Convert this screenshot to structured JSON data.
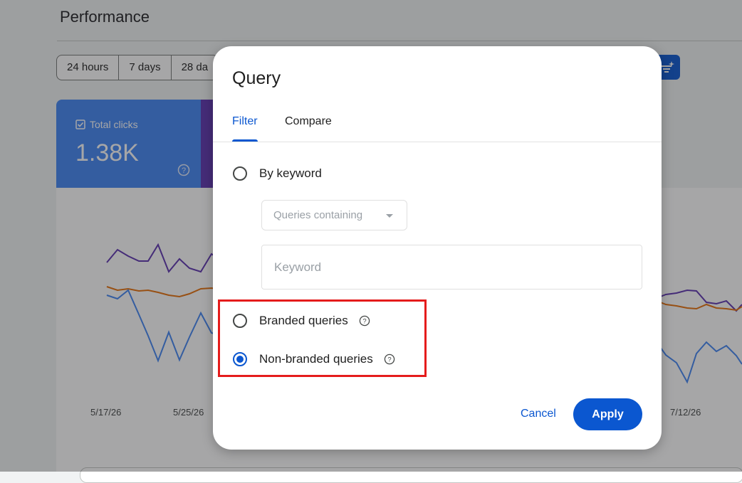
{
  "background": {
    "page_title": "Performance",
    "date_ranges": [
      "24 hours",
      "7 days",
      "28 da"
    ],
    "metric_card": {
      "label": "Total clicks",
      "value": "1.38K"
    },
    "x_ticks": [
      "5/17/26",
      "5/25/26",
      "7/12/26"
    ]
  },
  "dialog": {
    "title": "Query",
    "tabs": {
      "filter": "Filter",
      "compare": "Compare"
    },
    "options": {
      "by_keyword": "By keyword",
      "branded": "Branded queries",
      "non_branded": "Non-branded queries"
    },
    "selected_option": "non_branded",
    "match_select": "Queries containing",
    "keyword_placeholder": "Keyword",
    "cancel_label": "Cancel",
    "apply_label": "Apply"
  },
  "colors": {
    "accent": "#0b57d0",
    "clicks": "#4285f4",
    "impressions": "#5e35b1",
    "ctr": "#e8710a",
    "highlight": "#e51c1c"
  }
}
